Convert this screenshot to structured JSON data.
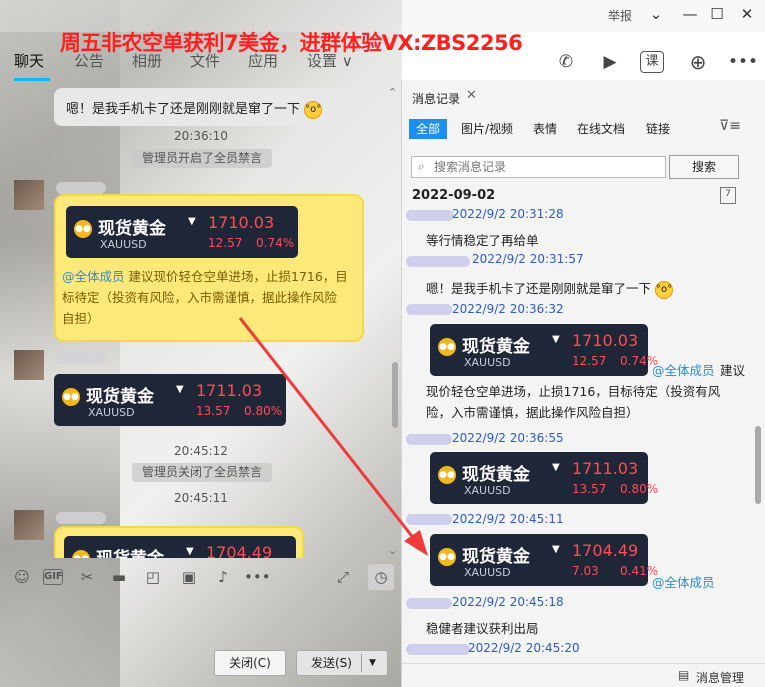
{
  "promo_banner": "周五非农空单获利7美金，进群体验VX:ZBS2256",
  "window": {
    "report": "举报",
    "min_icon": "chevron-down-icon",
    "max_icon": "maximize-icon",
    "close_icon": "close-icon"
  },
  "tabs": [
    {
      "label": "聊天"
    },
    {
      "label": "公告"
    },
    {
      "label": "相册"
    },
    {
      "label": "文件"
    },
    {
      "label": "应用"
    },
    {
      "label": "设置 ∨"
    }
  ],
  "top_icons": {
    "phone": "phone-icon",
    "video": "video-icon",
    "lesson": "课",
    "add": "plus-icon",
    "more": "more-icon"
  },
  "chat": {
    "top_bubble": "嗯！是我手机卡了还是刚刚就是窜了一下",
    "time1": "20:36:10",
    "sys1": "管理员开启了全员禁言",
    "card1": {
      "name": "现货黄金",
      "symbol": "XAUUSD",
      "price": "1710.03",
      "change": "12.57",
      "pct": "0.74%"
    },
    "gold_msg_mention": "@全体成员",
    "gold_msg_line1": " 建议现价轻仓空单进场，止损1716，目",
    "gold_msg_line2": "标待定（投资有风险，入市需谨慎，据此操作风险",
    "gold_msg_line3": "自担）",
    "card2": {
      "name": "现货黄金",
      "symbol": "XAUUSD",
      "price": "1711.03",
      "change": "13.57",
      "pct": "0.80%"
    },
    "time2": "20:45:12",
    "sys2": "管理员关闭了全员禁言",
    "time3": "20:45:11",
    "card3": {
      "name": "现货黄金",
      "price": "1704.49"
    }
  },
  "toolbar": {
    "close": "关闭(C)",
    "send": "发送(S)"
  },
  "history": {
    "title": "消息记录",
    "tabs": [
      "全部",
      "图片/视频",
      "表情",
      "在线文档",
      "链接"
    ],
    "search_placeholder": "搜索消息记录",
    "search_btn": "搜索",
    "date": "2022-09-02",
    "calendar": "7",
    "entries": {
      "t1": "2022/9/2 20:31:28",
      "m1": "等行情稳定了再给单",
      "t2": "2022/9/2 20:31:57",
      "m2": "嗯！是我手机卡了还是刚刚就是窜了一下",
      "t3": "2022/9/2 20:36:32",
      "mention": "@全体成员",
      "m3a": "建议",
      "m3b": "现价轻仓空单进场，止损1716，目标待定（投资有风",
      "m3c": "险，入市需谨慎，据此操作风险自担）",
      "t4": "2022/9/2 20:36:55",
      "t5": "2022/9/2 20:45:11",
      "t6": "2022/9/2 20:45:18",
      "m6": "稳健者建议获利出局",
      "t7": "2022/9/2 20:45:20"
    },
    "card_a": {
      "name": "现货黄金",
      "symbol": "XAUUSD",
      "price": "1710.03",
      "change": "12.57",
      "pct": "0.74%"
    },
    "card_b": {
      "name": "现货黄金",
      "symbol": "XAUUSD",
      "price": "1711.03",
      "change": "13.57",
      "pct": "0.80%"
    },
    "card_c": {
      "name": "现货黄金",
      "symbol": "XAUUSD",
      "price": "1704.49",
      "change": "7.03",
      "pct": "0.41%"
    },
    "card_c_mention": "@全体成员",
    "footer": "消息管理"
  },
  "colors": {
    "accent": "#12b7f5",
    "tab_active": "#1d8ef3",
    "promo": "#ff1f1f",
    "gold_bg": "#fde979",
    "card_bg": "#1f2638",
    "price": "#ff4d4f",
    "arrow": "#f03b3b"
  }
}
